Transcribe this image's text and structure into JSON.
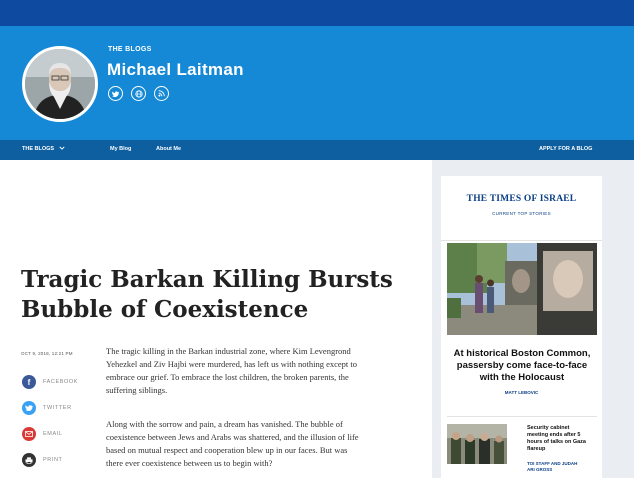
{
  "header": {
    "kicker": "THE BLOGS",
    "author_name": "Michael Laitman",
    "social_icons": [
      "twitter-icon",
      "globe-icon",
      "rss-icon"
    ]
  },
  "nav": {
    "the_blogs": "THE BLOGS",
    "my_blog": "My Blog",
    "about_me": "About Me",
    "apply": "APPLY FOR A BLOG"
  },
  "article": {
    "title_line1": "Tragic Barkan Killing Bursts",
    "title_line2": "Bubble of Coexistence",
    "date": "OCT 9, 2018, 12:21 PM",
    "para1_l1": "The tragic killing in the Barkan industrial zone, where Kim Levengrond",
    "para1_l2": "Yehezkel and Ziv Hajbi were murdered, has left us with nothing except to",
    "para1_l3": "embrace our grief. To embrace the lost children, the broken parents, the",
    "para1_l4": "suffering siblings.",
    "para2_l1": "Along with the sorrow and pain, a dream has vanished. The bubble of",
    "para2_l2": "coexistence between Jews and Arabs was shattered, and the illusion of life",
    "para2_l3": "based on mutual respect and cooperation blew up in our faces. But was",
    "para2_l4": "there ever coexistence between us to begin with?"
  },
  "share": {
    "facebook": "FACEBOOK",
    "twitter": "TWITTER",
    "email": "EMAIL",
    "print": "PRINT"
  },
  "sidebar": {
    "logo": "THE TIMES OF ISRAEL",
    "subtitle": "CURRENT TOP STORIES",
    "story1_l1": "At historical Boston Common,",
    "story1_l2": "passersby come face-to-face",
    "story1_l3": "with the Holocaust",
    "story1_author": "MATT LEBOVIC",
    "story2_l1": "Security cabinet",
    "story2_l2": "meeting ends after 5",
    "story2_l3": "hours of talks on Gaza",
    "story2_l4": "flareup",
    "story2_author_l1": "TOI STAFF AND JUDAH",
    "story2_author_l2": "ARI GROSS"
  },
  "colors": {
    "header_blue": "#1589d6",
    "nav_blue": "#0e5fa0",
    "top_strip": "#0d4aa0",
    "facebook": "#3b5998",
    "twitter": "#38a1f3",
    "email": "#d93a36",
    "print": "#333333",
    "brand_navy": "#0b3f86"
  }
}
